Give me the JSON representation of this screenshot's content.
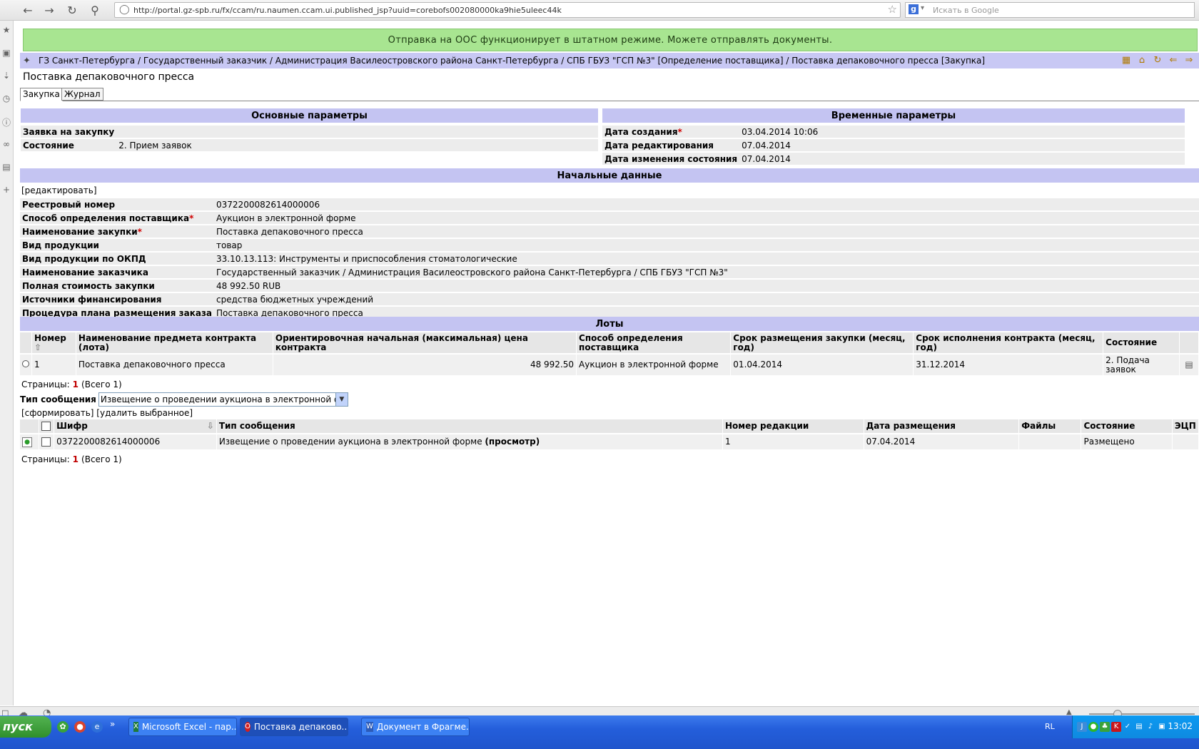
{
  "browser": {
    "url": "http://portal.gz-spb.ru/fx/ccam/ru.naumen.ccam.ui.published_jsp?uuid=corebofs002080000ka9hie5uleec44k",
    "search_placeholder": "Искать в Google"
  },
  "status_message": "Отправка на ООС функционирует в штатном режиме. Можете отправлять документы.",
  "breadcrumb": "ГЗ Санкт-Петербурга / Государственный заказчик / Администрация Василеостровского района Санкт-Петербурга / СПБ ГБУЗ \"ГСП №3\" [Определение поставщика] / Поставка депаковочного пресса [Закупка]",
  "page_title": "Поставка депаковочного пресса",
  "tabs": [
    {
      "label": "Закупка",
      "active": true
    },
    {
      "label": "Журнал",
      "active": false
    }
  ],
  "main_params": {
    "title": "Основные параметры",
    "rows": [
      {
        "label": "Заявка на закупку",
        "value": ""
      },
      {
        "label": "Состояние",
        "value": "2. Прием заявок"
      }
    ]
  },
  "time_params": {
    "title": "Временные параметры",
    "rows": [
      {
        "label": "Дата создания",
        "required": true,
        "value": "03.04.2014 10:06"
      },
      {
        "label": "Дата редактирования",
        "value": "07.04.2014"
      },
      {
        "label": "Дата изменения состояния",
        "value": "07.04.2014"
      }
    ]
  },
  "initial_data": {
    "title": "Начальные данные",
    "edit_link": "[редактировать]",
    "rows": [
      {
        "label": "Реестровый номер",
        "value": "0372200082614000006"
      },
      {
        "label": "Способ определения поставщика",
        "required": true,
        "value": "Аукцион в электронной форме"
      },
      {
        "label": "Наименование закупки",
        "required": true,
        "value": "Поставка депаковочного пресса"
      },
      {
        "label": "Вид продукции",
        "value": "товар"
      },
      {
        "label": "Вид продукции по ОКПД",
        "value": "33.10.13.113: Инструменты и приспособления стоматологические"
      },
      {
        "label": "Наименование заказчика",
        "value": "Государственный заказчик / Администрация Василеостровского района Санкт-Петербурга / СПБ ГБУЗ \"ГСП №3\""
      },
      {
        "label": "Полная стоимость закупки",
        "value": "48 992.50 RUB"
      },
      {
        "label": "Источники финансирования",
        "value": "средства бюджетных учреждений"
      },
      {
        "label": "Процедура плана размещения заказа",
        "value": "Поставка депаковочного пресса"
      }
    ]
  },
  "lots": {
    "title": "Лоты",
    "columns": [
      "Номер",
      "Наименование предмета контракта (лота)",
      "Ориентировочная начальная (максимальная) цена контракта",
      "Способ определения поставщика",
      "Срок размещения закупки (месяц, год)",
      "Срок исполнения контракта (месяц, год)",
      "Состояние"
    ],
    "rows": [
      {
        "number": "1",
        "name": "Поставка депаковочного пресса",
        "price": "48 992.50",
        "method": "Аукцион в электронной форме",
        "placement": "01.04.2014",
        "execution": "31.12.2014",
        "state": "2. Подача заявок"
      }
    ],
    "pages_label": "Страницы:",
    "current_page": "1",
    "total": "(Всего 1)"
  },
  "message_type": {
    "label": "Тип сообщения",
    "selected": "Извещение о проведении аукциона в электронной форме"
  },
  "messages": {
    "actions": "[сформировать] [удалить выбранное]",
    "columns": [
      "Шифр",
      "Тип сообщения",
      "Номер редакции",
      "Дата размещения",
      "Файлы",
      "Состояние",
      "ЭЦП"
    ],
    "rows": [
      {
        "code": "0372200082614000006",
        "type": "Извещение о проведении аукциона в электронной форме",
        "view": "(просмотр)",
        "revision": "1",
        "date": "07.04.2014",
        "files": "",
        "state": "Размещено",
        "sign": ""
      }
    ],
    "pages_label": "Страницы:",
    "current_page": "1",
    "total": "(Всего 1)"
  },
  "taskbar": {
    "start": "пуск",
    "tasks": [
      {
        "label": "Microsoft Excel - пар...",
        "active": false
      },
      {
        "label": "Поставка депаково...",
        "active": true
      },
      {
        "label": "Документ в Фрагме...",
        "active": false
      }
    ],
    "lang": "RL",
    "clock": "13:02"
  },
  "colors": {
    "status_green": "#a8e591",
    "section_header": "#c4c4f2",
    "breadcrumb_bg": "#c8c8f4"
  }
}
